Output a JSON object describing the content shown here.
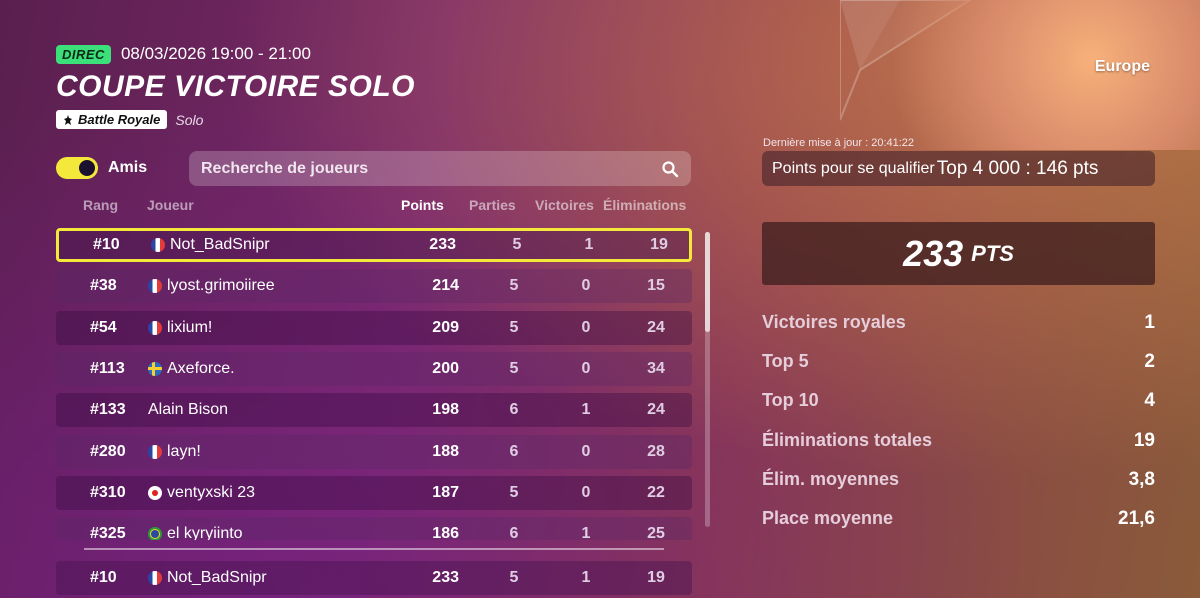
{
  "event": {
    "live_label": "DIREC",
    "time": "08/03/2026 19:00 - 21:00",
    "title": "COUPE VICTOIRE SOLO",
    "mode_label": "Battle Royale",
    "mode_sub": "Solo"
  },
  "controls": {
    "friends_toggle_label": "Amis",
    "friends_toggle_on": true,
    "search_placeholder": "Recherche de joueurs"
  },
  "table": {
    "headers": {
      "rank": "Rang",
      "player": "Joueur",
      "points": "Points",
      "games": "Parties",
      "wins": "Victoires",
      "elims": "Éliminations"
    },
    "rows": [
      {
        "rank": "#10",
        "flag": "fr",
        "player": "Not_BadSnipr",
        "points": "233",
        "games": "5",
        "wins": "1",
        "elims": "19",
        "highlight": true
      },
      {
        "rank": "#38",
        "flag": "fr",
        "player": "lyost.grimoiiree",
        "points": "214",
        "games": "5",
        "wins": "0",
        "elims": "15"
      },
      {
        "rank": "#54",
        "flag": "fr",
        "player": "lixium!",
        "points": "209",
        "games": "5",
        "wins": "0",
        "elims": "24"
      },
      {
        "rank": "#113",
        "flag": "se",
        "player": "Axeforce.",
        "points": "200",
        "games": "5",
        "wins": "0",
        "elims": "34"
      },
      {
        "rank": "#133",
        "flag": "",
        "player": "Alain Bison",
        "points": "198",
        "games": "6",
        "wins": "1",
        "elims": "24"
      },
      {
        "rank": "#280",
        "flag": "fr",
        "player": "layn!",
        "points": "188",
        "games": "6",
        "wins": "0",
        "elims": "28"
      },
      {
        "rank": "#310",
        "flag": "jp",
        "player": "ventyxski 23",
        "points": "187",
        "games": "5",
        "wins": "0",
        "elims": "22"
      },
      {
        "rank": "#325",
        "flag": "br",
        "player": "el kyryiinto",
        "points": "186",
        "games": "6",
        "wins": "1",
        "elims": "25"
      }
    ],
    "self_row": {
      "rank": "#10",
      "flag": "fr",
      "player": "Not_BadSnipr",
      "points": "233",
      "games": "5",
      "wins": "1",
      "elims": "19"
    }
  },
  "panel": {
    "region": "Europe",
    "updated": "Dernière mise à jour : 20:41:22",
    "qualify_label": "Points pour se qualifier",
    "qualify_value": "Top 4 000 : 146 pts",
    "score": "233",
    "score_unit": "PTS",
    "stats": [
      {
        "label": "Victoires royales",
        "value": "1"
      },
      {
        "label": "Top 5",
        "value": "2"
      },
      {
        "label": "Top 10",
        "value": "4"
      },
      {
        "label": "Éliminations totales",
        "value": "19"
      },
      {
        "label": "Élim. moyennes",
        "value": "3,8"
      },
      {
        "label": "Place moyenne",
        "value": "21,6"
      }
    ]
  },
  "colors": {
    "live": "#3be07a",
    "highlight": "#f4e83a",
    "toggle": "#f4e83a"
  }
}
